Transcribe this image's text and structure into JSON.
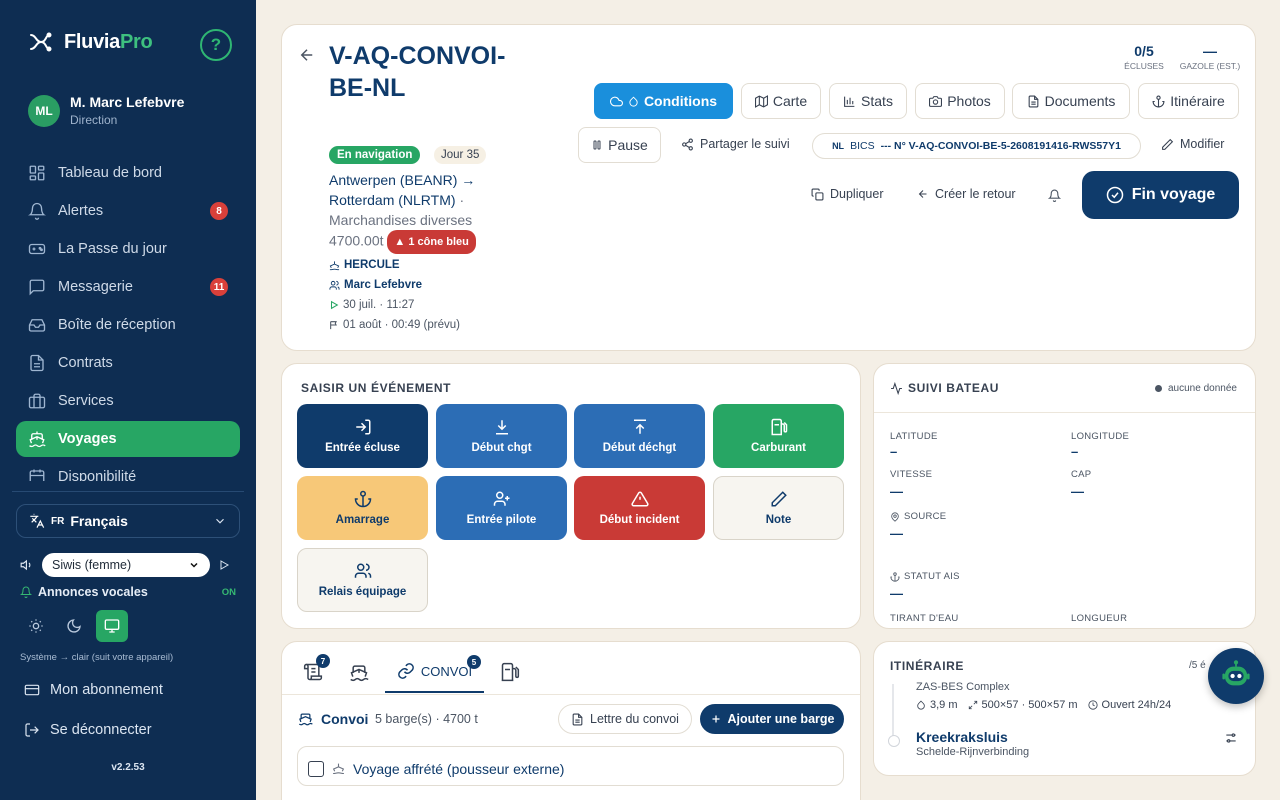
{
  "brand": {
    "name_main": "Fluvia",
    "name_accent": "Pro",
    "help_label": "?"
  },
  "user": {
    "initials": "ML",
    "name": "M. Marc Lefebvre",
    "role": "Direction"
  },
  "nav": {
    "items": [
      {
        "label": "Tableau de bord",
        "icon": "dashboard-icon"
      },
      {
        "label": "Alertes",
        "icon": "bell-icon",
        "badge": "8"
      },
      {
        "label": "La Passe du jour",
        "icon": "gamepad-icon"
      },
      {
        "label": "Messagerie",
        "icon": "chat-icon",
        "badge": "11"
      },
      {
        "label": "Boîte de réception",
        "icon": "inbox-icon"
      },
      {
        "label": "Contrats",
        "icon": "document-icon"
      },
      {
        "label": "Services",
        "icon": "briefcase-icon"
      },
      {
        "label": "Voyages",
        "icon": "ship-icon",
        "active": true
      },
      {
        "label": "Disponibilité",
        "icon": "calendar-icon"
      }
    ]
  },
  "settings": {
    "lang_code": "FR",
    "lang_label": "Français",
    "voice_value": "Siwis (femme)",
    "announcements_label": "Annonces vocales",
    "announcements_state": "ON",
    "theme_note": "Système → clair (suit votre appareil)",
    "subscription_label": "Mon abonnement",
    "logout_label": "Se déconnecter",
    "version": "v2.2.53"
  },
  "voyage": {
    "title": "V-AQ-CONVOI-BE-NL",
    "status": "En navigation",
    "day": "Jour 35",
    "route_from": "Antwerpen (BEANR) →",
    "route_to": "Rotterdam (NLRTM)",
    "route_sep": "·",
    "cargo": "Marchandises diverses",
    "tonnage": "4700.00t",
    "cone": "1 cône bleu",
    "vessel": "HERCULE",
    "captain": "Marc Lefebvre",
    "departure": "30 juil. · 11:27",
    "arrival": "01 août · 00:49 (prévu)"
  },
  "stats": {
    "locks_value": "0/5",
    "locks_label": "ÉCLUSES",
    "fuel_value": "—",
    "fuel_label": "GAZOLE (EST.)"
  },
  "toolbar": {
    "conditions": "Conditions",
    "map": "Carte",
    "stats": "Stats",
    "photos": "Photos",
    "documents": "Documents",
    "itinerary": "Itinéraire",
    "pause": "Pause",
    "share": "Partager le suivi",
    "bics_prefix": "NL",
    "bics_label": "BICS",
    "bics_ref": "--- N° V-AQ-CONVOI-BE-5-2608191416-RWS57Y1",
    "edit": "Modifier",
    "duplicate": "Dupliquer",
    "return_trip": "Créer le retour",
    "finish": "Fin voyage"
  },
  "events": {
    "title": "SAISIR UN ÉVÉNEMENT",
    "items": [
      {
        "label": "Entrée écluse",
        "icon": "enter-icon",
        "color": "#0f3b6b"
      },
      {
        "label": "Début chgt",
        "icon": "download-icon",
        "color": "#2c6db5"
      },
      {
        "label": "Début déchgt",
        "icon": "upload-icon",
        "color": "#2c6db5"
      },
      {
        "label": "Carburant",
        "icon": "fuel-icon",
        "color": "#27a664"
      },
      {
        "label": "Amarrage",
        "icon": "anchor-icon",
        "color": "#f7c878"
      },
      {
        "label": "Entrée pilote",
        "icon": "user-plus-icon",
        "color": "#2c6db5"
      },
      {
        "label": "Début incident",
        "icon": "warning-icon",
        "color": "#c93a36"
      },
      {
        "label": "Note",
        "icon": "pencil-icon",
        "color": "#f7f5f0"
      },
      {
        "label": "Relais équipage",
        "icon": "users-icon",
        "color": "#f7f5f0"
      }
    ]
  },
  "tracking": {
    "title": "SUIVI BATEAU",
    "status": "aucune donnée",
    "latitude_label": "LATITUDE",
    "latitude_value": "–",
    "longitude_label": "LONGITUDE",
    "longitude_value": "–",
    "speed_label": "VITESSE",
    "speed_value": "—",
    "heading_label": "CAP",
    "heading_value": "—",
    "source_label": "SOURCE",
    "source_value": "—",
    "ais_label": "STATUT AIS",
    "ais_value": "—",
    "draft_label": "TIRANT D'EAU",
    "length_label": "LONGUEUR"
  },
  "tabs": {
    "logbook_badge": "7",
    "convoy_label": "CONVOI",
    "convoy_badge": "5"
  },
  "convoy": {
    "title": "Convoi",
    "summary": "5 barge(s) · 4700 t",
    "letter_button": "Lettre du convoi",
    "add_button": "Ajouter une barge",
    "chartered_label": "Voyage affrété (pousseur externe)"
  },
  "itinerary": {
    "title": "ITINÉRAIRE",
    "counter": "/5 é",
    "prev_name": "ZAS-BES Complex",
    "prev_depth": "3,9 m",
    "prev_dims": "500×57 · 500×57 m",
    "prev_hours": "Ouvert 24h/24",
    "next_name": "Kreekraksluis",
    "next_sub": "Schelde-Rijnverbinding"
  }
}
